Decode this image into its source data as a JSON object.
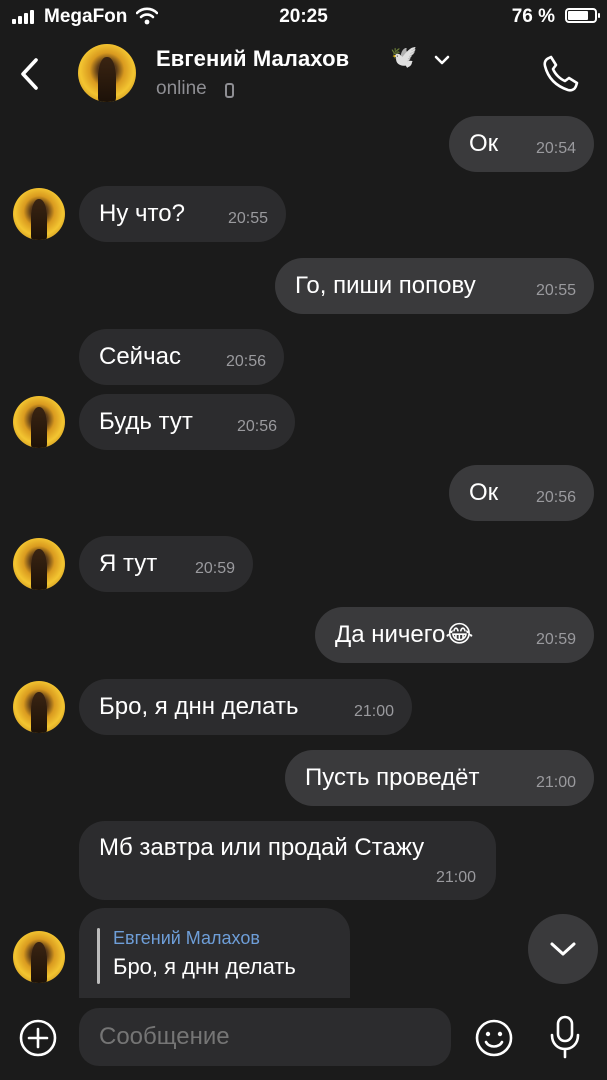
{
  "status_bar": {
    "carrier": "MegaFon",
    "time": "20:25",
    "battery": "76 %",
    "battery_level": 0.76
  },
  "header": {
    "name": "Евгений Малахов",
    "name_emoji": "🕊️",
    "status": "online"
  },
  "messages": [
    {
      "dir": "out",
      "text": "Ок",
      "time": "20:54"
    },
    {
      "dir": "in",
      "text": "Ну что?",
      "time": "20:55"
    },
    {
      "dir": "out",
      "text": "Го, пиши попову",
      "time": "20:55"
    },
    {
      "dir": "in",
      "text": "Сейчас",
      "time": "20:56"
    },
    {
      "dir": "in",
      "text": "Будь тут",
      "time": "20:56"
    },
    {
      "dir": "out",
      "text": "Ок",
      "time": "20:56"
    },
    {
      "dir": "in",
      "text": "Я тут",
      "time": "20:59"
    },
    {
      "dir": "out",
      "text": "Да ничего😂",
      "time": "20:59"
    },
    {
      "dir": "in",
      "text": "Бро, я днн делать",
      "time": "21:00"
    },
    {
      "dir": "out",
      "text": "Пусть проведёт",
      "time": "21:00"
    },
    {
      "dir": "in",
      "text": "Мб завтра или продай Стажу",
      "time": "21:00"
    }
  ],
  "reply_message": {
    "quoted_author": "Евгений Малахов",
    "quoted_text": "Бро, я днн делать"
  },
  "composer": {
    "placeholder": "Сообщение"
  }
}
